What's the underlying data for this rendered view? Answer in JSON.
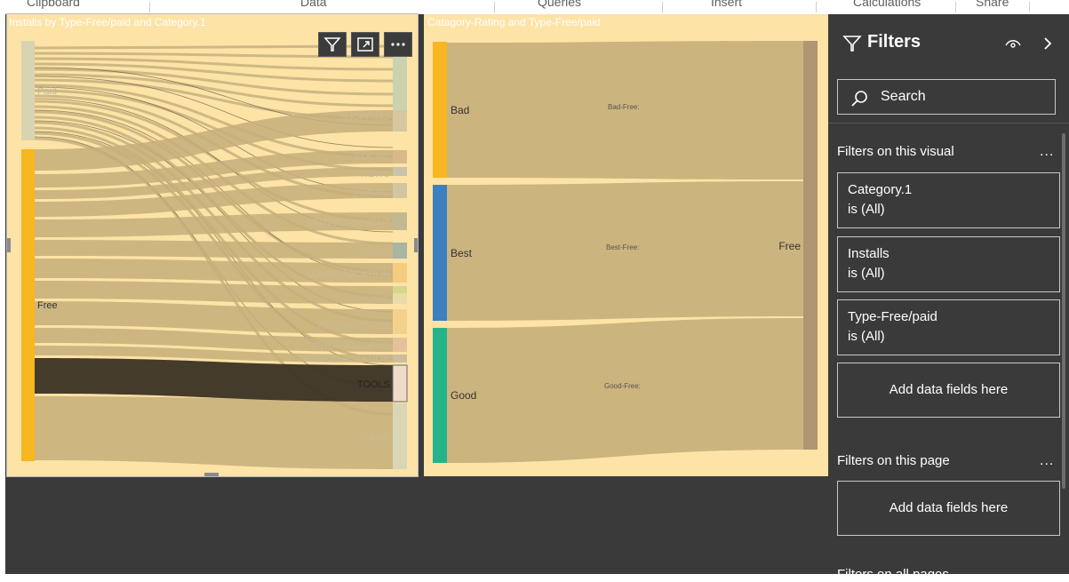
{
  "ribbon": {
    "groups": [
      "Clipboard",
      "Data",
      "Queries",
      "Insert",
      "Calculations",
      "Share"
    ]
  },
  "visual_left": {
    "title": "Installs by Type-Free/paid and Category.1",
    "left_nodes": [
      "Paid",
      "Free"
    ],
    "categories": [
      "SHOPPING",
      "SOCIAL",
      "NEWS",
      "TRAVEL",
      "ENTERTAINMENT",
      "VIDEO",
      "COMMUNICATION",
      "MUSIC",
      "PRODUCTIVITY",
      "PHOTOGRAPHY",
      "PERSONALIZATION",
      "TOOLS",
      "GAME"
    ],
    "buttons": {
      "filter_icon": "filter-icon",
      "focus_icon": "focus-mode-icon",
      "more_icon": "more-options-icon"
    }
  },
  "visual_right": {
    "title": "Catagory-Rating and Type-Free/paid",
    "left_nodes": [
      "Bad",
      "Best",
      "Good"
    ],
    "link_labels": [
      "Bad-Free:",
      "Best-Free:",
      "Good-Free:"
    ],
    "right_node": "Free",
    "colors": {
      "Bad": "#f8b620",
      "Best": "#3f7fbf",
      "Good": "#24b38b",
      "Free": "#b09673"
    }
  },
  "filters_pane": {
    "title": "Filters",
    "search_label": "Search",
    "section_visual": "Filters on this visual",
    "section_page": "Filters on this page",
    "section_all": "Filters on all pages",
    "more": "...",
    "visual_filters": [
      {
        "field": "Category.1",
        "state": "is (All)"
      },
      {
        "field": "Installs",
        "state": "is (All)"
      },
      {
        "field": "Type-Free/paid",
        "state": "is (All)"
      }
    ],
    "add_fields_visual": "Add data fields here",
    "add_fields_page": "Add data fields here",
    "icons": {
      "filter": "filter-icon",
      "eye": "eye-icon",
      "collapse": "chevron-right-icon",
      "search": "search-icon"
    }
  }
}
